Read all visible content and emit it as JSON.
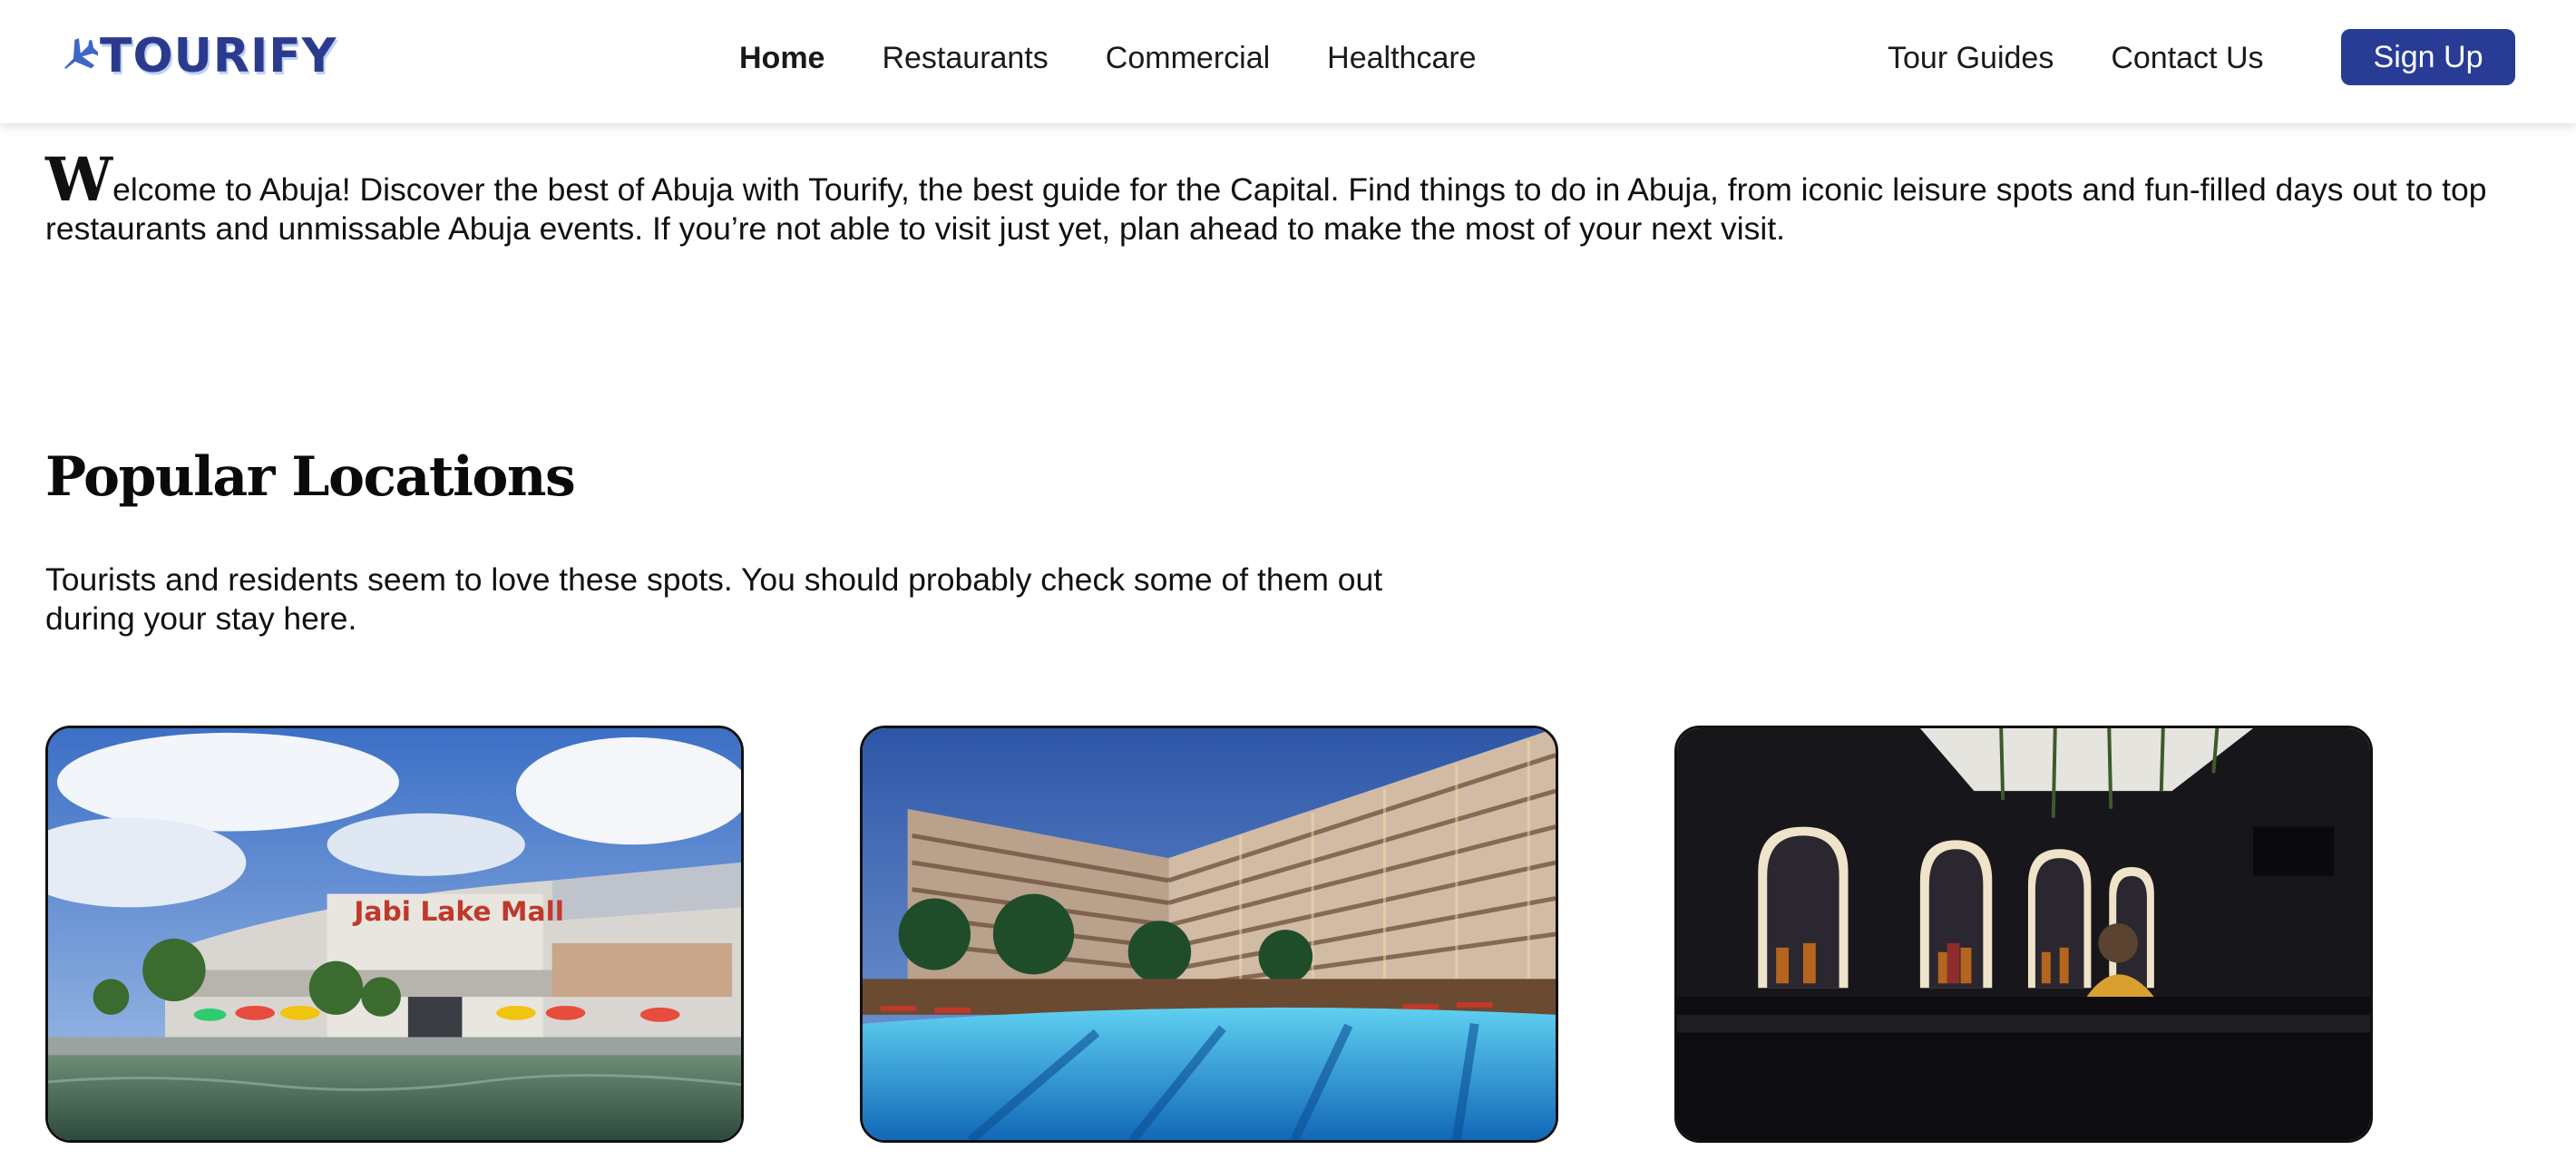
{
  "brand": {
    "name": "TOURIFY",
    "logo_icon": "airplane-icon",
    "color": "#2c3a8e"
  },
  "nav": {
    "center": [
      {
        "label": "Home",
        "active": true
      },
      {
        "label": "Restaurants"
      },
      {
        "label": "Commercial"
      },
      {
        "label": "Healthcare"
      }
    ],
    "right": [
      {
        "label": "Tour Guides"
      },
      {
        "label": "Contact Us"
      }
    ],
    "signup_label": "Sign Up",
    "signup_color": "#283c96"
  },
  "intro": {
    "dropcap": "W",
    "text": "elcome to Abuja! Discover the best of Abuja with Tourify, the best guide for the Capital. Find things to do in Abuja, from iconic leisure spots and fun-filled days out to top restaurants and unmissable Abuja events. If you’re not able to visit just yet, plan ahead to make the most of your next visit."
  },
  "popular": {
    "title": "Popular Locations",
    "subtitle": "Tourists and residents seem to love these spots. You should probably check some of them out during your stay here.",
    "cards": [
      {
        "image": "mall-by-lake-photo",
        "sign_text": "Jabi Lake Mall"
      },
      {
        "image": "hotel-with-pool-photo"
      },
      {
        "image": "dark-bar-lounge-photo"
      }
    ]
  }
}
